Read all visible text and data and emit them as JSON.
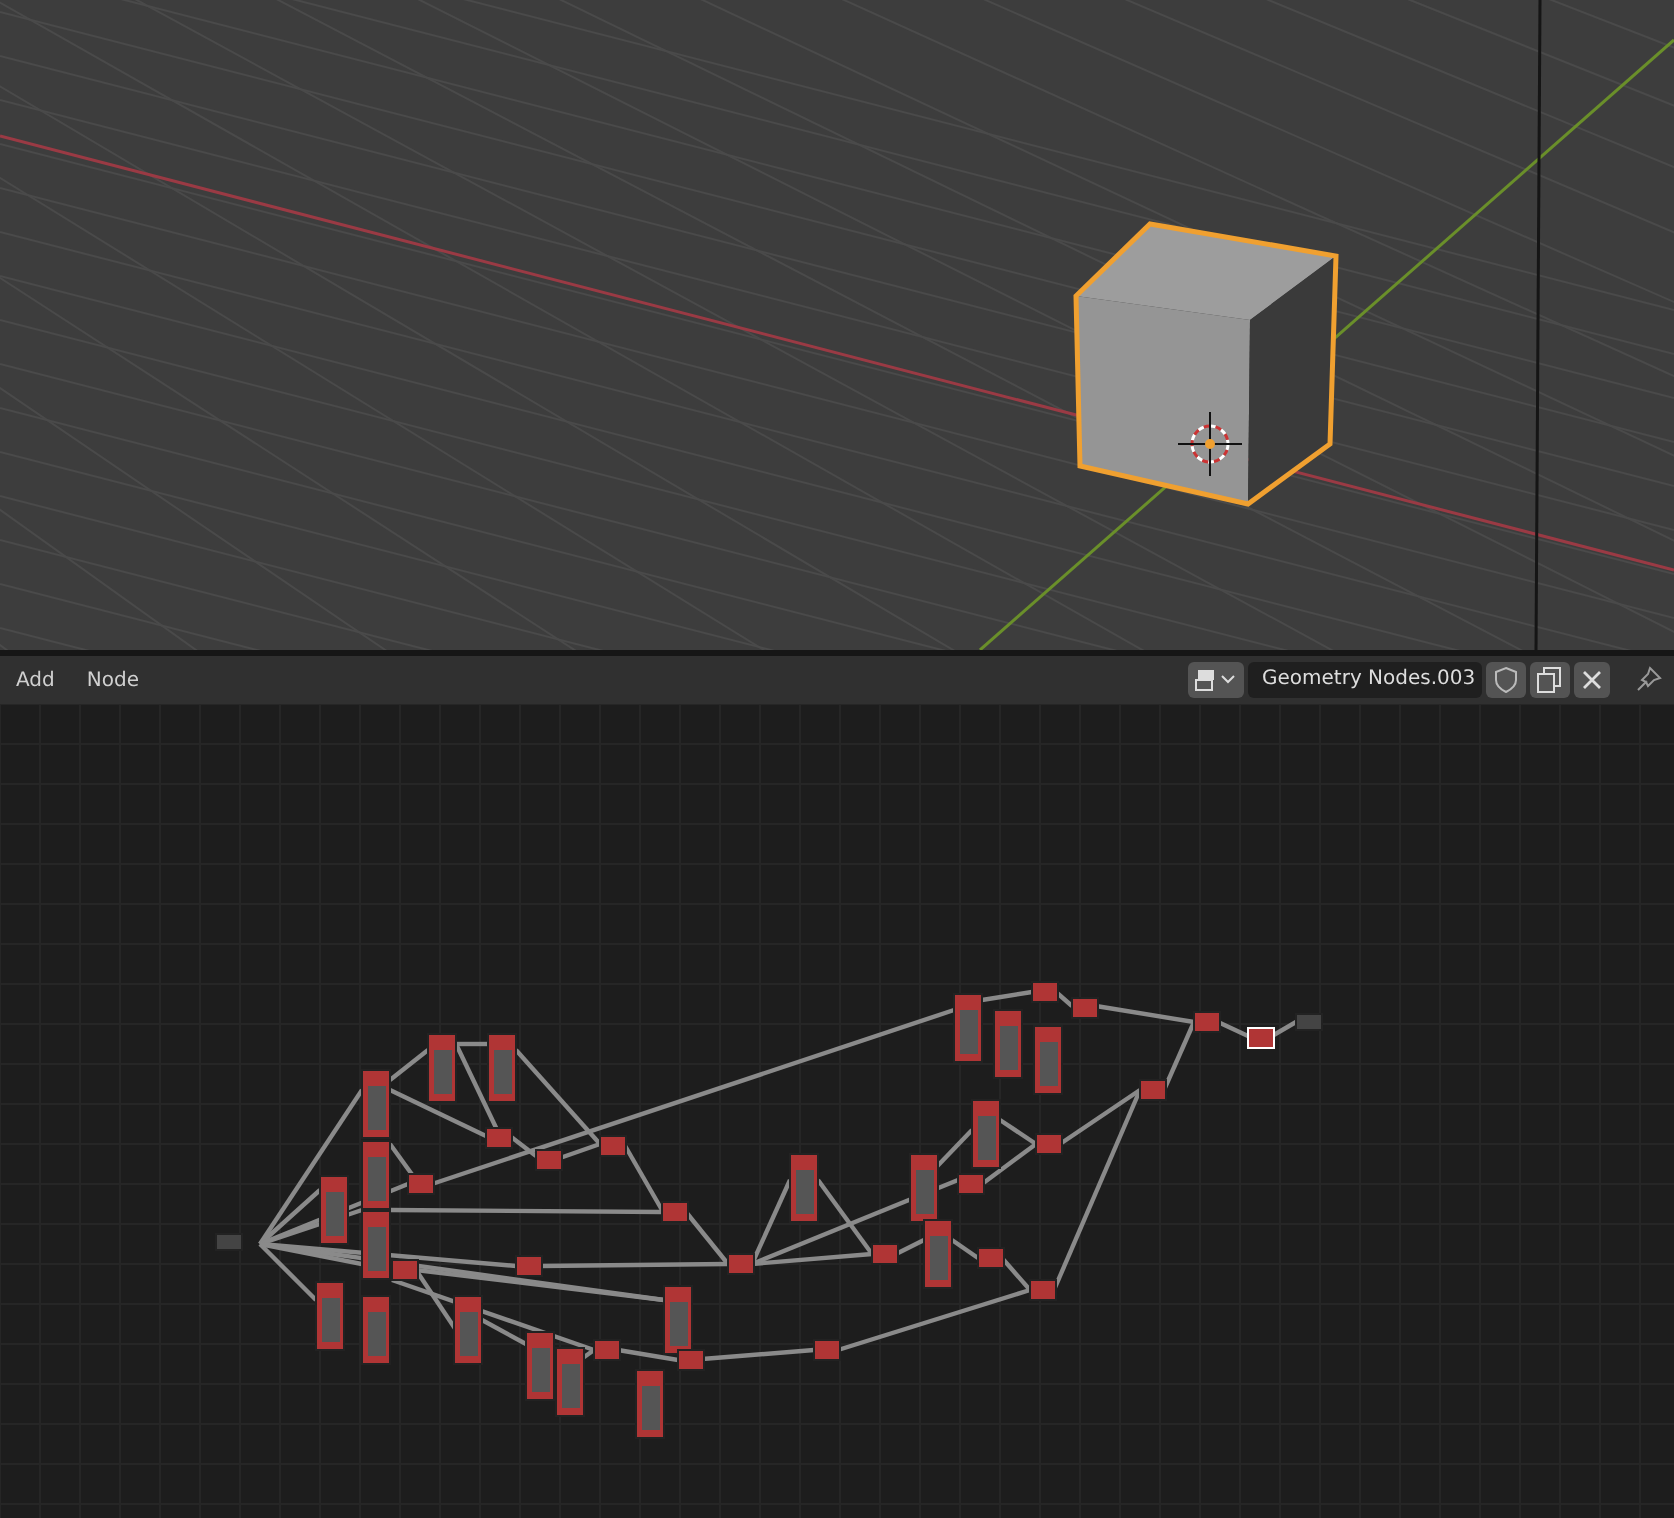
{
  "header": {
    "menus": [
      {
        "label": "Add"
      },
      {
        "label": "Node"
      }
    ],
    "node_tree": {
      "name": "Geometry Nodes.003"
    }
  }
}
